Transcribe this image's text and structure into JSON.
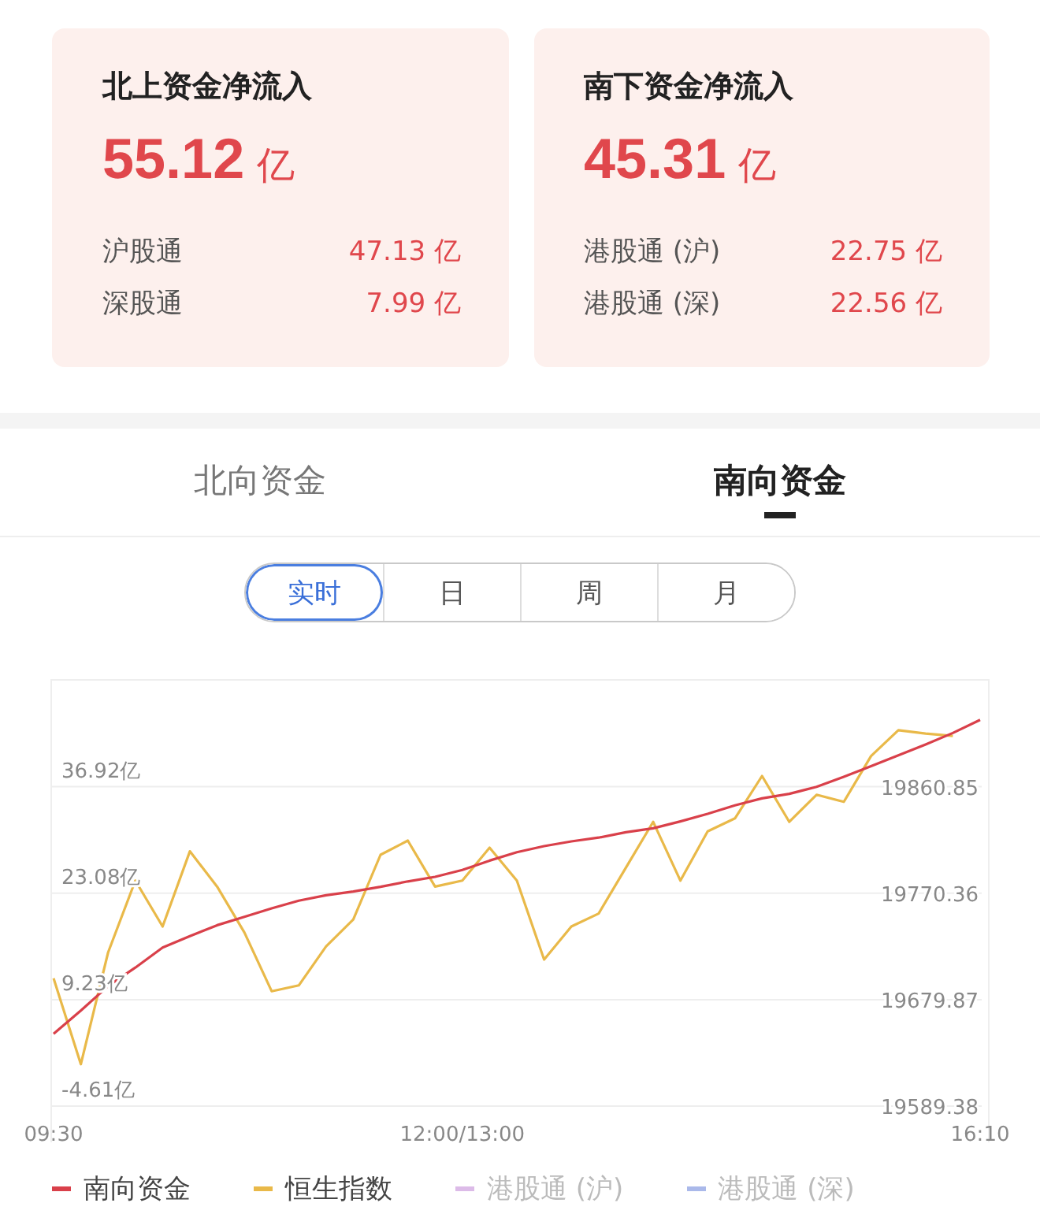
{
  "summary_cards": [
    {
      "title": "北上资金净流入",
      "amount": "55.12",
      "unit": "亿",
      "rows": [
        {
          "label": "沪股通",
          "value": "47.13 亿"
        },
        {
          "label": "深股通",
          "value": "7.99 亿"
        }
      ]
    },
    {
      "title": "南下资金净流入",
      "amount": "45.31",
      "unit": "亿",
      "rows": [
        {
          "label": "港股通 (沪)",
          "value": "22.75 亿"
        },
        {
          "label": "港股通 (深)",
          "value": "22.56 亿"
        }
      ]
    }
  ],
  "tabs": [
    {
      "label": "北向资金",
      "selected": false
    },
    {
      "label": "南向资金",
      "selected": true
    }
  ],
  "periods": [
    {
      "label": "实时",
      "selected": true
    },
    {
      "label": "日",
      "selected": false
    },
    {
      "label": "周",
      "selected": false
    },
    {
      "label": "月",
      "selected": false
    }
  ],
  "chart": {
    "chart_data": {
      "type": "line",
      "grid": true,
      "categories": [
        "09:30",
        null,
        null,
        null,
        null,
        null,
        null,
        null,
        null,
        null,
        null,
        null,
        null,
        null,
        null,
        "12:00/13:00",
        null,
        null,
        null,
        null,
        null,
        null,
        null,
        null,
        null,
        null,
        null,
        null,
        null,
        null,
        null,
        null,
        null,
        null,
        "16:10"
      ],
      "ylim": [
        -4.61,
        50.7
      ],
      "yticks": [
        {
          "value": 36.92,
          "label": "36.92亿"
        },
        {
          "value": 23.08,
          "label": "23.08亿"
        },
        {
          "value": 9.23,
          "label": "9.23亿"
        },
        {
          "value": -4.61,
          "label": "-4.61亿"
        }
      ],
      "y2lim": [
        19589.38,
        19951
      ],
      "y2ticks": [
        {
          "value": 19860.85,
          "label": "19860.85"
        },
        {
          "value": 19770.36,
          "label": "19770.36"
        },
        {
          "value": 19679.87,
          "label": "19679.87"
        },
        {
          "value": 19589.38,
          "label": "19589.38"
        }
      ],
      "series": [
        {
          "name": "南向资金",
          "color": "#d9404a",
          "values": [
            4.8,
            7.8,
            11.0,
            13.4,
            16.0,
            17.5,
            18.9,
            20.0,
            21.1,
            22.1,
            22.8,
            23.3,
            23.9,
            24.6,
            25.2,
            26.1,
            27.3,
            28.4,
            29.2,
            29.8,
            30.3,
            31.0,
            31.5,
            32.4,
            33.4,
            34.5,
            35.4,
            36.0,
            36.9,
            38.2,
            39.6,
            41.0,
            42.4,
            43.9,
            45.6
          ]
        },
        {
          "name": "恒生指数",
          "color": "#e9b949",
          "axis": "y2",
          "values": [
            19698,
            19625,
            19720,
            19781,
            19742,
            19806,
            19776,
            19737,
            19687,
            19692,
            19725,
            19748,
            19803,
            19815,
            19776,
            19781,
            19809,
            19781,
            19714,
            19742,
            19753,
            19792,
            19831,
            19781,
            19823,
            19834,
            19870,
            19831,
            19854,
            19848,
            19887,
            19909,
            19906,
            19904,
            null
          ]
        }
      ]
    },
    "legend": [
      {
        "label": "港股通 (沪)",
        "color": "#dcbbe8",
        "active": false
      },
      {
        "label": "港股通 (深)",
        "color": "#aab9ea",
        "active": false
      }
    ]
  }
}
